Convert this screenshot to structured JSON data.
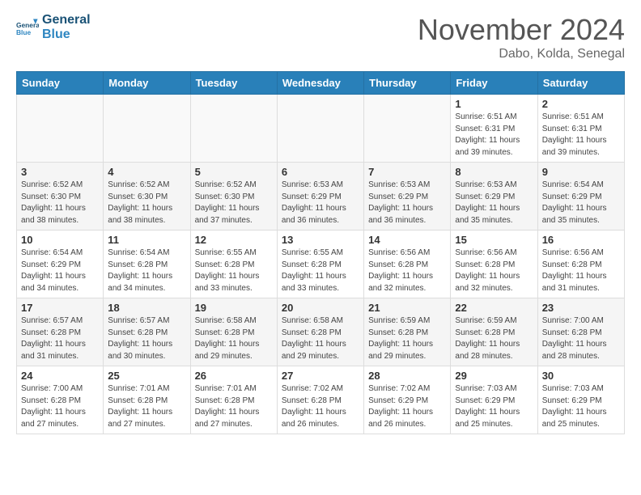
{
  "header": {
    "logo_line1": "General",
    "logo_line2": "Blue",
    "month": "November 2024",
    "location": "Dabo, Kolda, Senegal"
  },
  "days_of_week": [
    "Sunday",
    "Monday",
    "Tuesday",
    "Wednesday",
    "Thursday",
    "Friday",
    "Saturday"
  ],
  "weeks": [
    [
      {
        "day": "",
        "info": ""
      },
      {
        "day": "",
        "info": ""
      },
      {
        "day": "",
        "info": ""
      },
      {
        "day": "",
        "info": ""
      },
      {
        "day": "",
        "info": ""
      },
      {
        "day": "1",
        "info": "Sunrise: 6:51 AM\nSunset: 6:31 PM\nDaylight: 11 hours\nand 39 minutes."
      },
      {
        "day": "2",
        "info": "Sunrise: 6:51 AM\nSunset: 6:31 PM\nDaylight: 11 hours\nand 39 minutes."
      }
    ],
    [
      {
        "day": "3",
        "info": "Sunrise: 6:52 AM\nSunset: 6:30 PM\nDaylight: 11 hours\nand 38 minutes."
      },
      {
        "day": "4",
        "info": "Sunrise: 6:52 AM\nSunset: 6:30 PM\nDaylight: 11 hours\nand 38 minutes."
      },
      {
        "day": "5",
        "info": "Sunrise: 6:52 AM\nSunset: 6:30 PM\nDaylight: 11 hours\nand 37 minutes."
      },
      {
        "day": "6",
        "info": "Sunrise: 6:53 AM\nSunset: 6:29 PM\nDaylight: 11 hours\nand 36 minutes."
      },
      {
        "day": "7",
        "info": "Sunrise: 6:53 AM\nSunset: 6:29 PM\nDaylight: 11 hours\nand 36 minutes."
      },
      {
        "day": "8",
        "info": "Sunrise: 6:53 AM\nSunset: 6:29 PM\nDaylight: 11 hours\nand 35 minutes."
      },
      {
        "day": "9",
        "info": "Sunrise: 6:54 AM\nSunset: 6:29 PM\nDaylight: 11 hours\nand 35 minutes."
      }
    ],
    [
      {
        "day": "10",
        "info": "Sunrise: 6:54 AM\nSunset: 6:29 PM\nDaylight: 11 hours\nand 34 minutes."
      },
      {
        "day": "11",
        "info": "Sunrise: 6:54 AM\nSunset: 6:28 PM\nDaylight: 11 hours\nand 34 minutes."
      },
      {
        "day": "12",
        "info": "Sunrise: 6:55 AM\nSunset: 6:28 PM\nDaylight: 11 hours\nand 33 minutes."
      },
      {
        "day": "13",
        "info": "Sunrise: 6:55 AM\nSunset: 6:28 PM\nDaylight: 11 hours\nand 33 minutes."
      },
      {
        "day": "14",
        "info": "Sunrise: 6:56 AM\nSunset: 6:28 PM\nDaylight: 11 hours\nand 32 minutes."
      },
      {
        "day": "15",
        "info": "Sunrise: 6:56 AM\nSunset: 6:28 PM\nDaylight: 11 hours\nand 32 minutes."
      },
      {
        "day": "16",
        "info": "Sunrise: 6:56 AM\nSunset: 6:28 PM\nDaylight: 11 hours\nand 31 minutes."
      }
    ],
    [
      {
        "day": "17",
        "info": "Sunrise: 6:57 AM\nSunset: 6:28 PM\nDaylight: 11 hours\nand 31 minutes."
      },
      {
        "day": "18",
        "info": "Sunrise: 6:57 AM\nSunset: 6:28 PM\nDaylight: 11 hours\nand 30 minutes."
      },
      {
        "day": "19",
        "info": "Sunrise: 6:58 AM\nSunset: 6:28 PM\nDaylight: 11 hours\nand 29 minutes."
      },
      {
        "day": "20",
        "info": "Sunrise: 6:58 AM\nSunset: 6:28 PM\nDaylight: 11 hours\nand 29 minutes."
      },
      {
        "day": "21",
        "info": "Sunrise: 6:59 AM\nSunset: 6:28 PM\nDaylight: 11 hours\nand 29 minutes."
      },
      {
        "day": "22",
        "info": "Sunrise: 6:59 AM\nSunset: 6:28 PM\nDaylight: 11 hours\nand 28 minutes."
      },
      {
        "day": "23",
        "info": "Sunrise: 7:00 AM\nSunset: 6:28 PM\nDaylight: 11 hours\nand 28 minutes."
      }
    ],
    [
      {
        "day": "24",
        "info": "Sunrise: 7:00 AM\nSunset: 6:28 PM\nDaylight: 11 hours\nand 27 minutes."
      },
      {
        "day": "25",
        "info": "Sunrise: 7:01 AM\nSunset: 6:28 PM\nDaylight: 11 hours\nand 27 minutes."
      },
      {
        "day": "26",
        "info": "Sunrise: 7:01 AM\nSunset: 6:28 PM\nDaylight: 11 hours\nand 27 minutes."
      },
      {
        "day": "27",
        "info": "Sunrise: 7:02 AM\nSunset: 6:28 PM\nDaylight: 11 hours\nand 26 minutes."
      },
      {
        "day": "28",
        "info": "Sunrise: 7:02 AM\nSunset: 6:29 PM\nDaylight: 11 hours\nand 26 minutes."
      },
      {
        "day": "29",
        "info": "Sunrise: 7:03 AM\nSunset: 6:29 PM\nDaylight: 11 hours\nand 25 minutes."
      },
      {
        "day": "30",
        "info": "Sunrise: 7:03 AM\nSunset: 6:29 PM\nDaylight: 11 hours\nand 25 minutes."
      }
    ]
  ]
}
